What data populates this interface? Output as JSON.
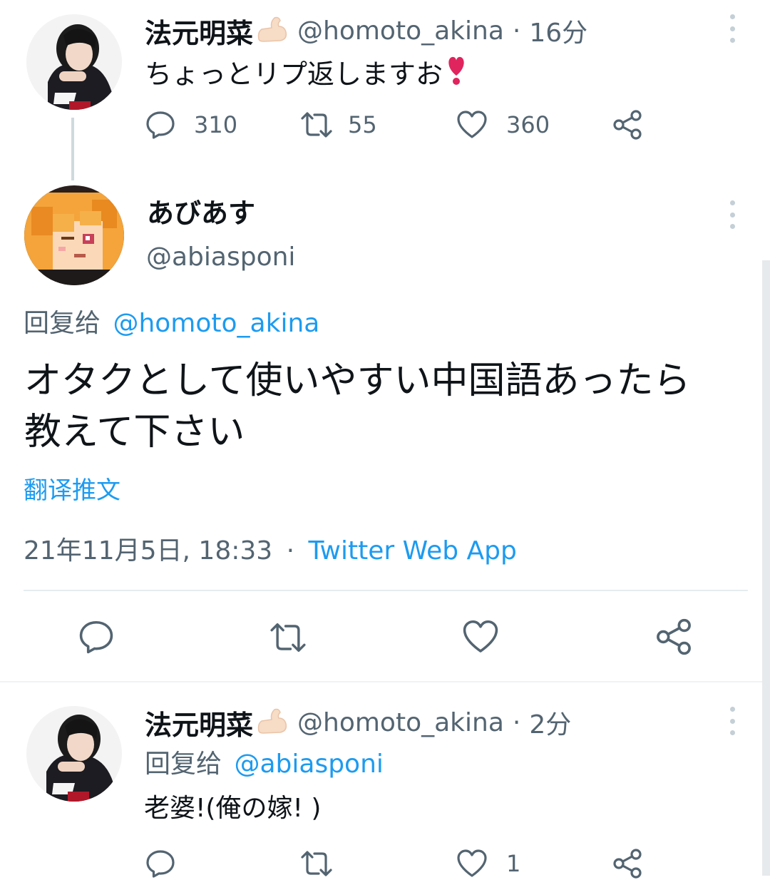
{
  "tweet1": {
    "display_name": "法元明菜",
    "handle": "@homoto_akina",
    "separator": "·",
    "time": "16分",
    "text": "ちょっとリプ返しますお",
    "emoji": "heavy-heart-exclamation",
    "replies": "310",
    "retweets": "55",
    "likes": "360"
  },
  "tweet2": {
    "display_name": "あびあす",
    "handle": "@abiasponi",
    "reply_prefix": "回复给",
    "reply_to": "@homoto_akina",
    "text": "オタクとして使いやすい中国語あったら教えて下さい",
    "translate": "翻译推文",
    "datetime": "21年11月5日, 18:33",
    "separator": "·",
    "source": "Twitter Web App"
  },
  "tweet3": {
    "display_name": "法元明菜",
    "handle": "@homoto_akina",
    "separator": "·",
    "time": "2分",
    "reply_prefix": "回复给",
    "reply_to": "@abiasponi",
    "text": "老婆!(俺の嫁! )",
    "likes": "1"
  },
  "colors": {
    "text": "#0f1419",
    "muted": "#536471",
    "link": "#1d9bf0",
    "thread_line": "#cfd9de",
    "divider": "#eff3f4",
    "heart_emoji": "#e0245e"
  }
}
